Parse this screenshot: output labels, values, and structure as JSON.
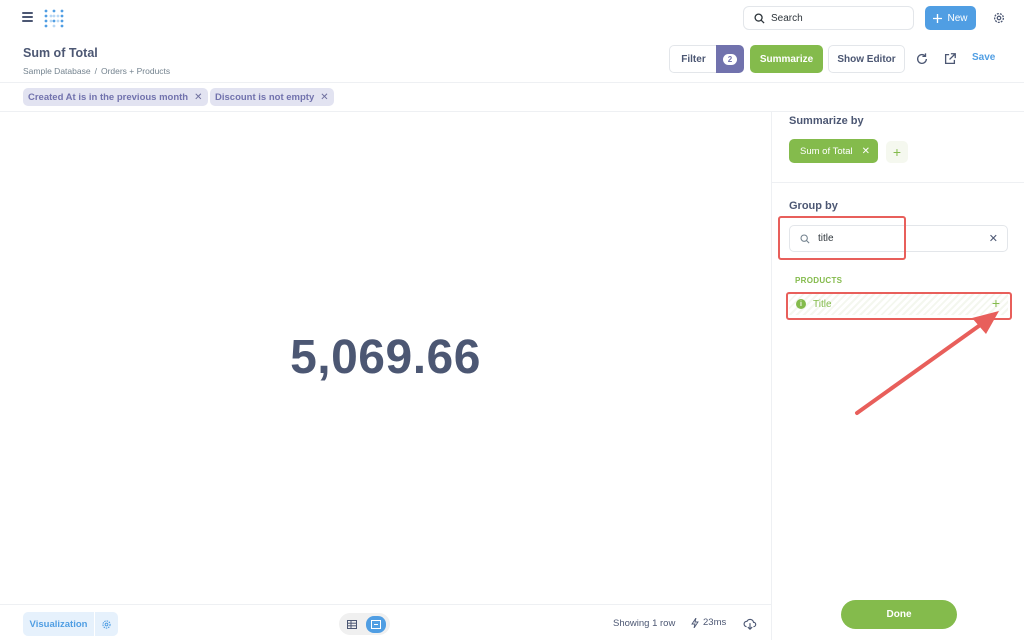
{
  "topnav": {
    "search_label": "Search",
    "new_label": "New"
  },
  "header": {
    "title": "Sum of Total",
    "breadcrumb": [
      "Sample Database",
      "/",
      "Orders + Products"
    ],
    "filter_label": "Filter",
    "filter_count": "2",
    "summarize_label": "Summarize",
    "show_editor_label": "Show Editor",
    "save_label": "Save"
  },
  "filters": [
    {
      "label": "Created At is in the previous month"
    },
    {
      "label": "Discount is not empty"
    }
  ],
  "result": {
    "value": "5,069.66"
  },
  "sidebar": {
    "summarize_by_title": "Summarize by",
    "metric_label": "Sum of Total",
    "group_by_title": "Group by",
    "search_value": "title",
    "section_label": "PRODUCTS",
    "field_label": "Title",
    "done_label": "Done"
  },
  "footer": {
    "visualization_label": "Visualization",
    "row_count": "Showing 1 row",
    "timing": "23ms"
  },
  "colors": {
    "brand": "#509ee3",
    "summarize": "#84bb4c",
    "filter": "#7172ad",
    "annotation": "#e85f5b"
  }
}
